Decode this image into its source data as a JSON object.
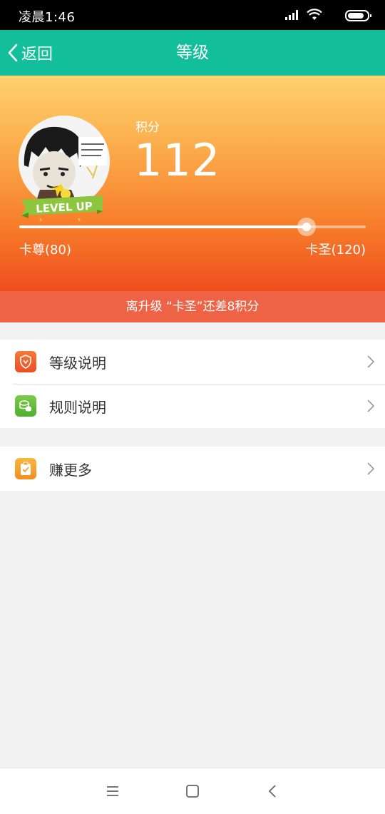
{
  "status_bar": {
    "time": "凌晨1:46",
    "icons": [
      "signal-icon",
      "wifi-icon",
      "battery-icon"
    ]
  },
  "nav": {
    "back_label": "返回",
    "title": "等级"
  },
  "profile": {
    "badge_text": "LEVEL UP",
    "points_label": "积分",
    "points_value": "112",
    "progress_fraction": 0.83,
    "current_level": "卡尊(80)",
    "next_level": "卡圣(120)",
    "notice": "离升级 “卡圣”还差8积分"
  },
  "menu_group_1": [
    {
      "label": "等级说明",
      "icon": "shield-icon",
      "color": "#f0642e"
    },
    {
      "label": "规则说明",
      "icon": "coins-icon",
      "color": "#5dbb3a"
    }
  ],
  "menu_group_2": [
    {
      "label": "赚更多",
      "icon": "clipboard-icon",
      "color": "#f5a12c"
    }
  ],
  "bottom_nav": [
    "menu-icon",
    "home-icon",
    "back-icon"
  ],
  "colors": {
    "nav_bg": "#13bf9a",
    "notice_bg": "#ee6246",
    "page_bg": "#f2f2f2"
  }
}
